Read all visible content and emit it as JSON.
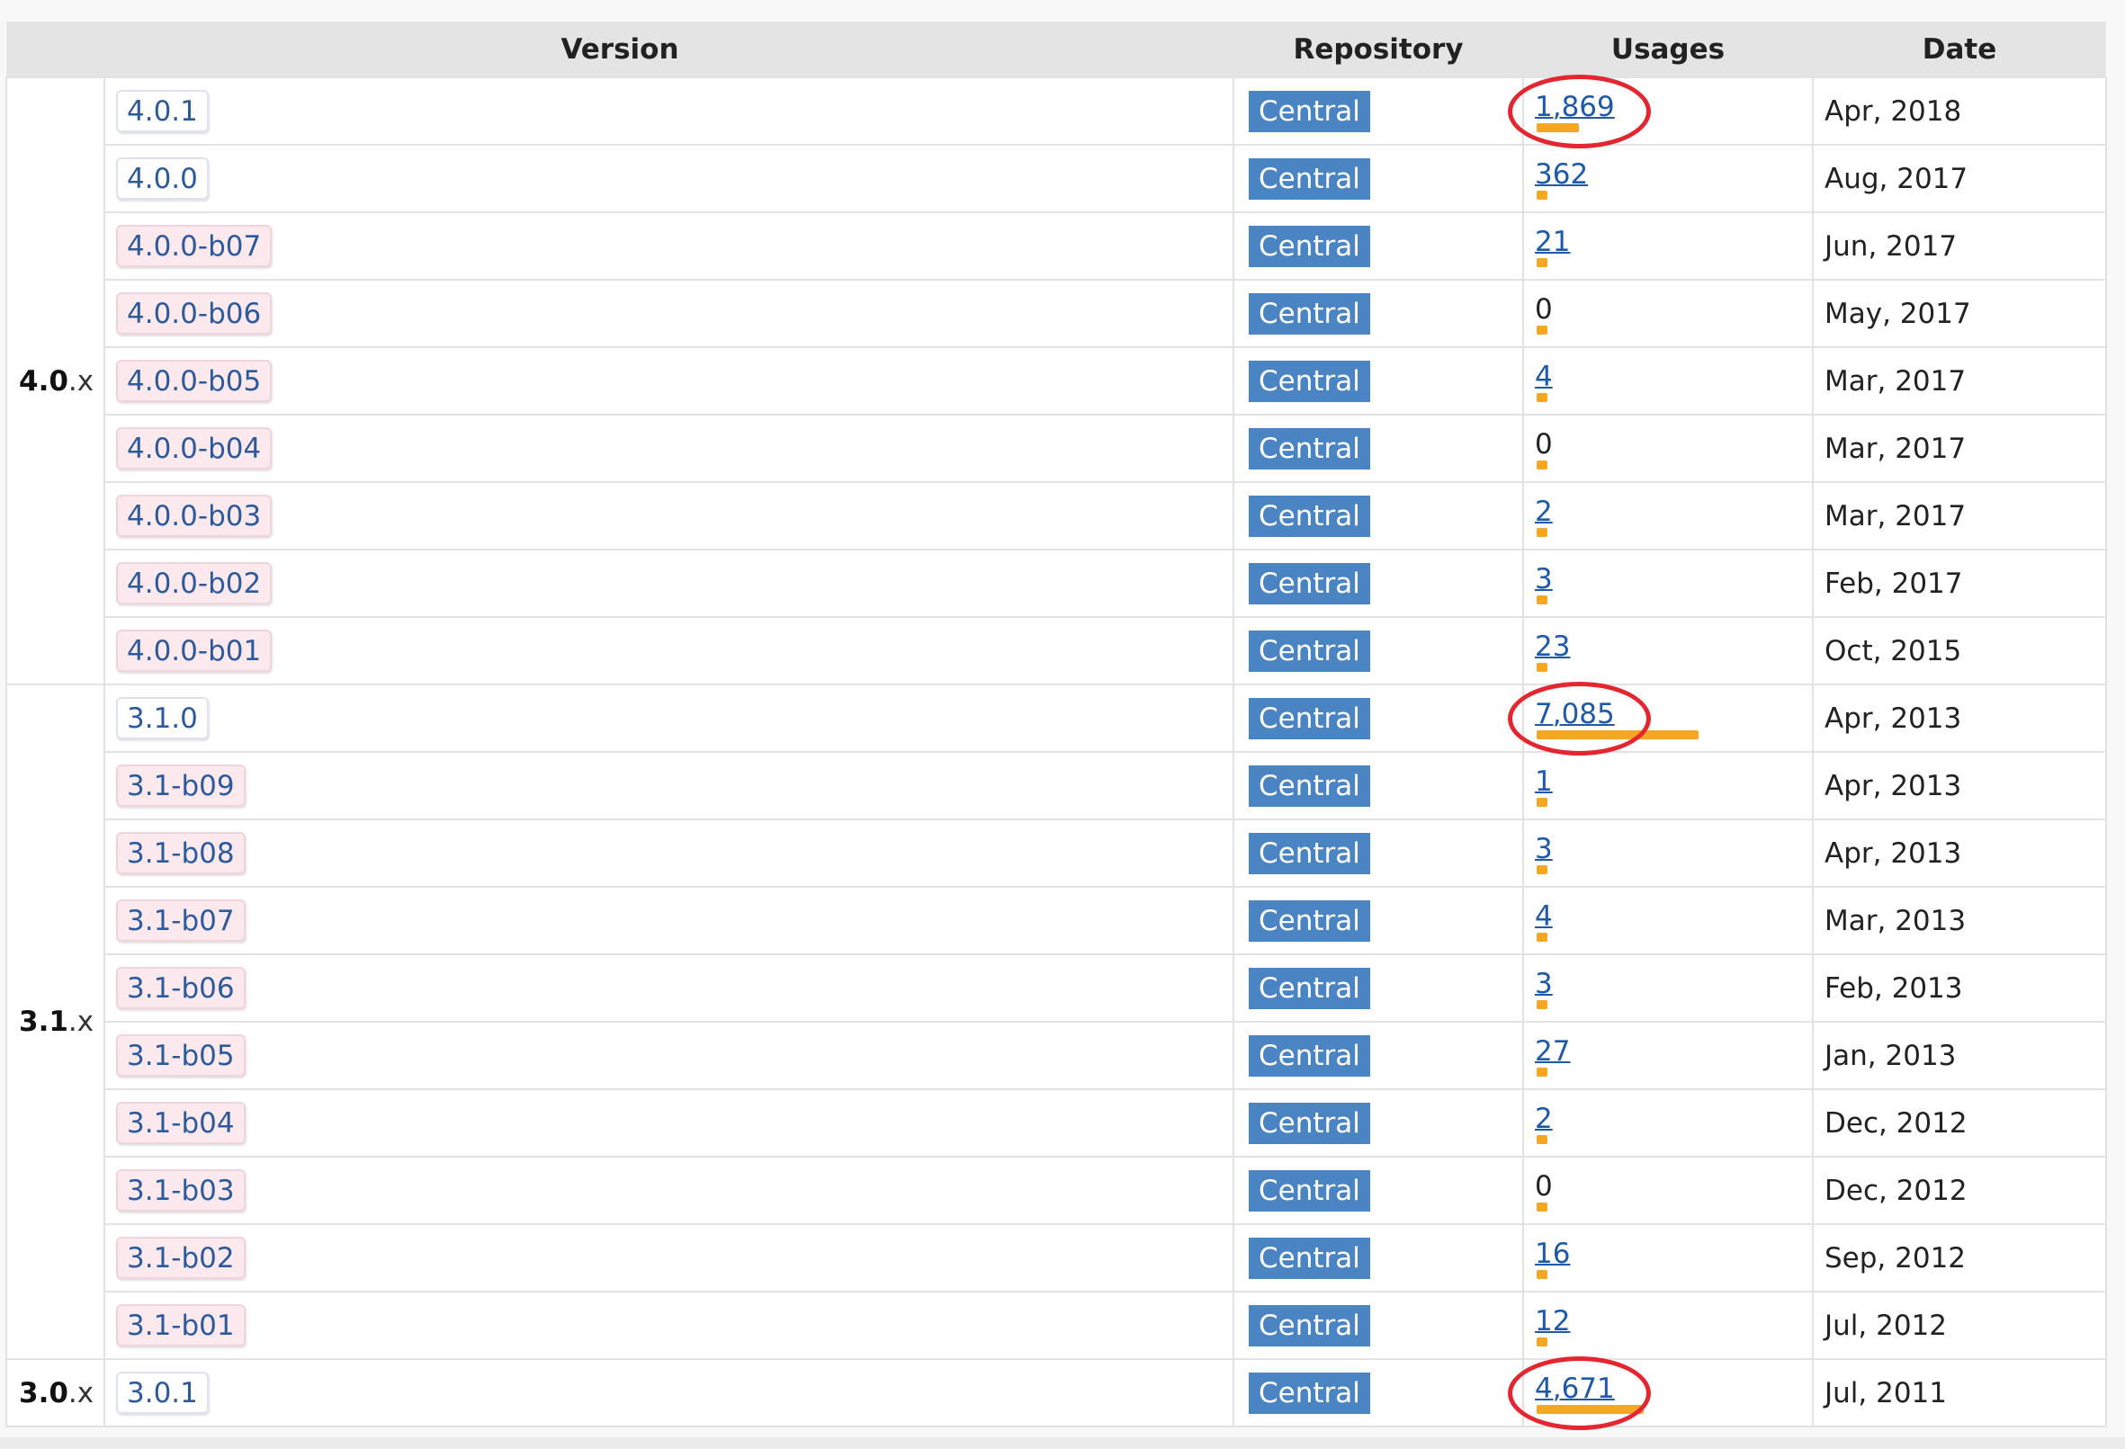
{
  "headers": {
    "version": "Version",
    "repository": "Repository",
    "usages": "Usages",
    "date": "Date"
  },
  "groups": [
    {
      "major": "4.0",
      "suffix": ".x",
      "rows": [
        {
          "version": "4.0.1",
          "beta": false,
          "repo": "Central",
          "usages": "1,869",
          "date": "Apr, 2018"
        },
        {
          "version": "4.0.0",
          "beta": false,
          "repo": "Central",
          "usages": "362",
          "date": "Aug, 2017"
        },
        {
          "version": "4.0.0-b07",
          "beta": true,
          "repo": "Central",
          "usages": "21",
          "date": "Jun, 2017"
        },
        {
          "version": "4.0.0-b06",
          "beta": true,
          "repo": "Central",
          "usages": "0",
          "date": "May, 2017"
        },
        {
          "version": "4.0.0-b05",
          "beta": true,
          "repo": "Central",
          "usages": "4",
          "date": "Mar, 2017"
        },
        {
          "version": "4.0.0-b04",
          "beta": true,
          "repo": "Central",
          "usages": "0",
          "date": "Mar, 2017"
        },
        {
          "version": "4.0.0-b03",
          "beta": true,
          "repo": "Central",
          "usages": "2",
          "date": "Mar, 2017"
        },
        {
          "version": "4.0.0-b02",
          "beta": true,
          "repo": "Central",
          "usages": "3",
          "date": "Feb, 2017"
        },
        {
          "version": "4.0.0-b01",
          "beta": true,
          "repo": "Central",
          "usages": "23",
          "date": "Oct, 2015"
        }
      ]
    },
    {
      "major": "3.1",
      "suffix": ".x",
      "rows": [
        {
          "version": "3.1.0",
          "beta": false,
          "repo": "Central",
          "usages": "7,085",
          "date": "Apr, 2013"
        },
        {
          "version": "3.1-b09",
          "beta": true,
          "repo": "Central",
          "usages": "1",
          "date": "Apr, 2013"
        },
        {
          "version": "3.1-b08",
          "beta": true,
          "repo": "Central",
          "usages": "3",
          "date": "Apr, 2013"
        },
        {
          "version": "3.1-b07",
          "beta": true,
          "repo": "Central",
          "usages": "4",
          "date": "Mar, 2013"
        },
        {
          "version": "3.1-b06",
          "beta": true,
          "repo": "Central",
          "usages": "3",
          "date": "Feb, 2013"
        },
        {
          "version": "3.1-b05",
          "beta": true,
          "repo": "Central",
          "usages": "27",
          "date": "Jan, 2013"
        },
        {
          "version": "3.1-b04",
          "beta": true,
          "repo": "Central",
          "usages": "2",
          "date": "Dec, 2012"
        },
        {
          "version": "3.1-b03",
          "beta": true,
          "repo": "Central",
          "usages": "0",
          "date": "Dec, 2012"
        },
        {
          "version": "3.1-b02",
          "beta": true,
          "repo": "Central",
          "usages": "16",
          "date": "Sep, 2012"
        },
        {
          "version": "3.1-b01",
          "beta": true,
          "repo": "Central",
          "usages": "12",
          "date": "Jul, 2012"
        }
      ]
    },
    {
      "major": "3.0",
      "suffix": ".x",
      "rows": [
        {
          "version": "3.0.1",
          "beta": false,
          "repo": "Central",
          "usages": "4,671",
          "date": "Jul, 2011"
        }
      ]
    }
  ],
  "colors": {
    "usage_bar": "#f5a623",
    "repo_badge": "#4a84c3",
    "link": "#1f5aa8",
    "highlight_ring": "#e3262f",
    "beta_badge_bg": "#fbe9ee"
  },
  "highlighted_usages": [
    "1,869",
    "7,085",
    "4,671"
  ]
}
